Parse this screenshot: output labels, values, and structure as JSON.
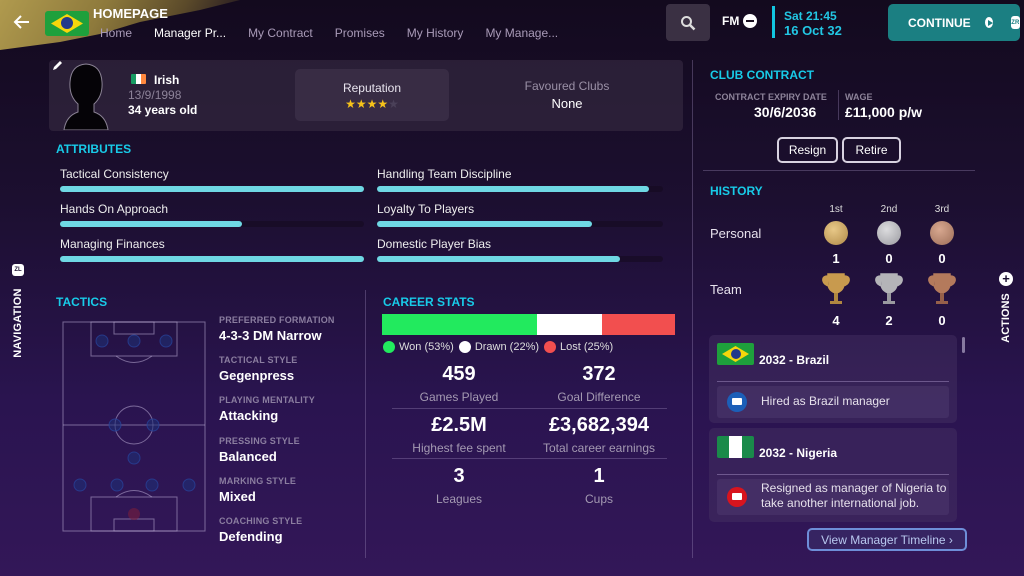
{
  "header": {
    "page_title": "HOMEPAGE",
    "tabs": [
      {
        "label": "Home",
        "active": false
      },
      {
        "label": "Manager Pr...",
        "active": true
      },
      {
        "label": "My Contract",
        "active": false
      },
      {
        "label": "Promises",
        "active": false
      },
      {
        "label": "My History",
        "active": false
      },
      {
        "label": "My Manage...",
        "active": false
      }
    ],
    "fm_label": "FM",
    "time": "Sat 21:45",
    "date": "16 Oct 32",
    "continue_label": "CONTINUE",
    "continue_badge": "ZR"
  },
  "side": {
    "navigation_label": "NAVIGATION",
    "navigation_badge": "ZL",
    "actions_label": "ACTIONS"
  },
  "profile": {
    "nationality": "Irish",
    "dob": "13/9/1998",
    "age": "34 years old",
    "reputation_label": "Reputation",
    "reputation_stars": 4,
    "reputation_max": 5,
    "favoured_clubs_label": "Favoured Clubs",
    "favoured_clubs_value": "None"
  },
  "attributes": {
    "title": "ATTRIBUTES",
    "items": [
      {
        "label": "Tactical Consistency",
        "value": 1.0
      },
      {
        "label": "Handling Team Discipline",
        "value": 0.95
      },
      {
        "label": "Hands On Approach",
        "value": 0.6
      },
      {
        "label": "Loyalty To Players",
        "value": 0.75
      },
      {
        "label": "Managing Finances",
        "value": 1.0
      },
      {
        "label": "Domestic Player Bias",
        "value": 0.85
      }
    ]
  },
  "tactics": {
    "title": "TACTICS",
    "fields": [
      {
        "label": "PREFERRED FORMATION",
        "value": "4-3-3 DM Narrow"
      },
      {
        "label": "TACTICAL STYLE",
        "value": "Gegenpress"
      },
      {
        "label": "PLAYING MENTALITY",
        "value": "Attacking"
      },
      {
        "label": "PRESSING STYLE",
        "value": "Balanced"
      },
      {
        "label": "MARKING STYLE",
        "value": "Mixed"
      },
      {
        "label": "COACHING STYLE",
        "value": "Defending"
      }
    ]
  },
  "career_stats": {
    "title": "CAREER STATS",
    "results": [
      {
        "label": "Won (53%)",
        "pct": 53,
        "color": "#22ea5e"
      },
      {
        "label": "Drawn (22%)",
        "pct": 22,
        "color": "#ffffff"
      },
      {
        "label": "Lost (25%)",
        "pct": 25,
        "color": "#f24f4f"
      }
    ],
    "stats": [
      {
        "value": "459",
        "label": "Games Played"
      },
      {
        "value": "372",
        "label": "Goal Difference"
      },
      {
        "value": "£2.5M",
        "label": "Highest fee spent"
      },
      {
        "value": "£3,682,394",
        "label": "Total career earnings"
      },
      {
        "value": "3",
        "label": "Leagues"
      },
      {
        "value": "1",
        "label": "Cups"
      }
    ]
  },
  "contract": {
    "title": "CLUB CONTRACT",
    "expiry_label": "CONTRACT EXPIRY DATE",
    "expiry_value": "30/6/2036",
    "wage_label": "WAGE",
    "wage_value": "£11,000 p/w",
    "resign_label": "Resign",
    "retire_label": "Retire"
  },
  "history": {
    "title": "HISTORY",
    "columns": [
      "1st",
      "2nd",
      "3rd"
    ],
    "personal_label": "Personal",
    "personal_counts": [
      "1",
      "0",
      "0"
    ],
    "team_label": "Team",
    "team_counts": [
      "4",
      "2",
      "0"
    ],
    "timeline": [
      {
        "title": "2032 - Brazil",
        "event": "Hired as Brazil manager",
        "event_type": "hired"
      },
      {
        "title": "2032 - Nigeria",
        "event": "Resigned as manager of Nigeria to take another international job.",
        "event_type": "resigned"
      }
    ],
    "timeline_button": "View Manager Timeline ›"
  },
  "colors": {
    "accent": "#18cbe8",
    "continue": "#1b7f82",
    "bar_fill": "#6fd8e4",
    "star": "#f6c31a"
  }
}
